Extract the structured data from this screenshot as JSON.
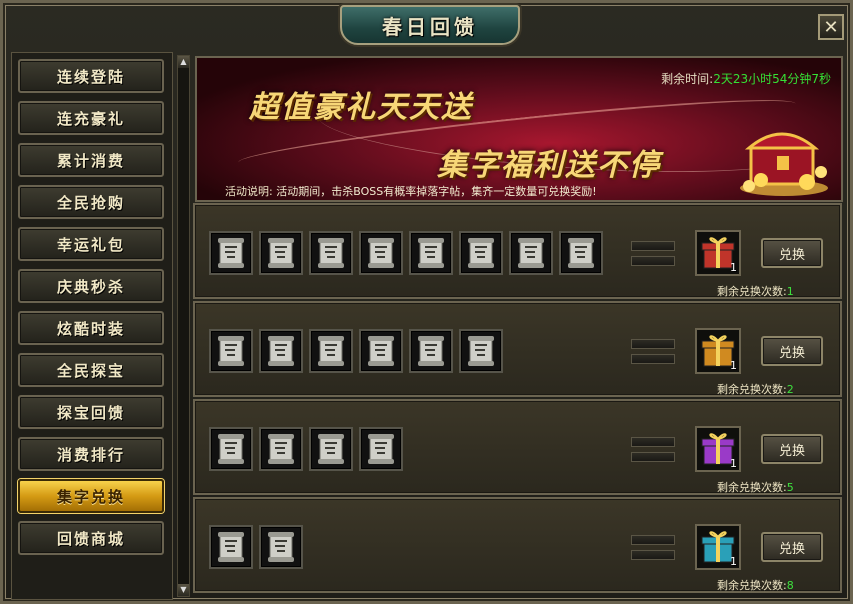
{
  "window": {
    "title": "春日回馈",
    "close_icon": "close-icon"
  },
  "sidebar": {
    "items": [
      {
        "label": "连续登陆",
        "active": false
      },
      {
        "label": "连充豪礼",
        "active": false
      },
      {
        "label": "累计消费",
        "active": false
      },
      {
        "label": "全民抢购",
        "active": false
      },
      {
        "label": "幸运礼包",
        "active": false
      },
      {
        "label": "庆典秒杀",
        "active": false
      },
      {
        "label": "炫酷时装",
        "active": false
      },
      {
        "label": "全民探宝",
        "active": false
      },
      {
        "label": "探宝回馈",
        "active": false
      },
      {
        "label": "消费排行",
        "active": false
      },
      {
        "label": "集字兑换",
        "active": true
      },
      {
        "label": "回馈商城",
        "active": false
      }
    ]
  },
  "banner": {
    "headline1": "超值豪礼天天送",
    "headline2": "集字福利送不停",
    "time_label": "剩余时间:",
    "time_value": "2天23小时54分钟7秒",
    "desc_label": "活动说明:",
    "desc_text": "活动期间，击杀BOSS有概率掉落字帖，集齐一定数量可兑换奖励!"
  },
  "rows": [
    {
      "scroll_count": 8,
      "gift_count": "1",
      "gift_color": "#c0342a",
      "button": "兑换",
      "remain_label": "剩余兑换次数:",
      "remain_value": "1"
    },
    {
      "scroll_count": 6,
      "gift_count": "1",
      "gift_color": "#d08a20",
      "button": "兑换",
      "remain_label": "剩余兑换次数:",
      "remain_value": "2"
    },
    {
      "scroll_count": 4,
      "gift_count": "1",
      "gift_color": "#9a3ac8",
      "button": "兑换",
      "remain_label": "剩余兑换次数:",
      "remain_value": "5"
    },
    {
      "scroll_count": 2,
      "gift_count": "1",
      "gift_color": "#2aa0b8",
      "button": "兑换",
      "remain_label": "剩余兑换次数:",
      "remain_value": "8"
    }
  ],
  "icons": {
    "scroll": "scroll-icon",
    "gift": "gift-box-icon",
    "chest": "treasure-chest-icon"
  }
}
